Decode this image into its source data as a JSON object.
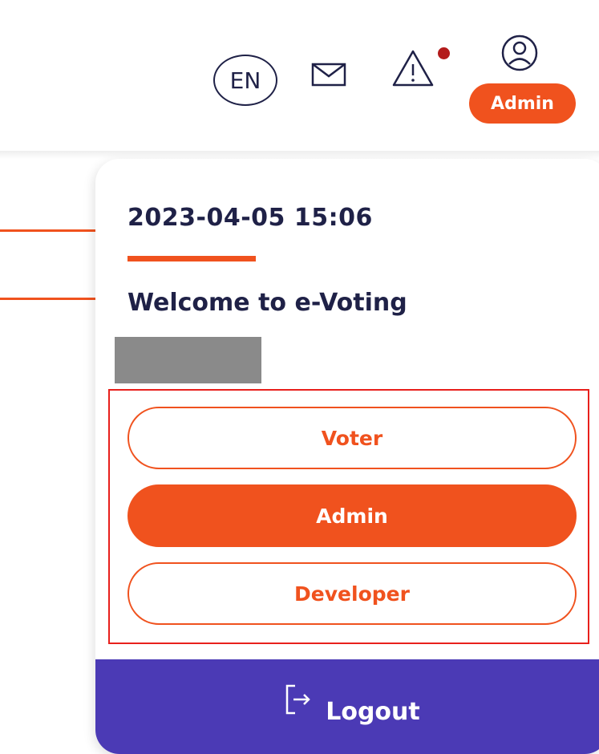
{
  "header": {
    "language_label": "EN",
    "role_badge": "Admin",
    "icons": [
      "mail-icon",
      "warning-icon",
      "user-icon"
    ],
    "alert_dot_color": "#b31b1b"
  },
  "menu": {
    "datetime": "2023-04-05 15:06",
    "welcome": "Welcome to e-Voting",
    "roles": [
      {
        "label": "Voter",
        "active": false
      },
      {
        "label": "Admin",
        "active": true
      },
      {
        "label": "Developer",
        "active": false
      }
    ],
    "logout_label": "Logout",
    "logout_icon": "logout-icon"
  },
  "colors": {
    "accent": "#f0521e",
    "text_dark": "#1f2147",
    "logout_bg": "#4b3ab5",
    "highlight_border": "#e8201c"
  }
}
